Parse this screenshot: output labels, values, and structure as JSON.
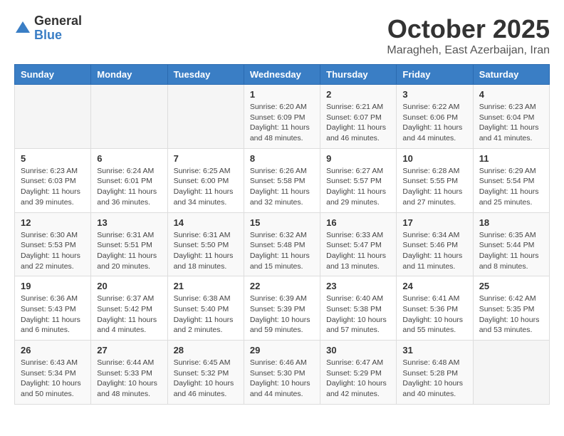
{
  "logo": {
    "general": "General",
    "blue": "Blue"
  },
  "header": {
    "month": "October 2025",
    "location": "Maragheh, East Azerbaijan, Iran"
  },
  "weekdays": [
    "Sunday",
    "Monday",
    "Tuesday",
    "Wednesday",
    "Thursday",
    "Friday",
    "Saturday"
  ],
  "weeks": [
    [
      {
        "day": "",
        "info": ""
      },
      {
        "day": "",
        "info": ""
      },
      {
        "day": "",
        "info": ""
      },
      {
        "day": "1",
        "info": "Sunrise: 6:20 AM\nSunset: 6:09 PM\nDaylight: 11 hours\nand 48 minutes."
      },
      {
        "day": "2",
        "info": "Sunrise: 6:21 AM\nSunset: 6:07 PM\nDaylight: 11 hours\nand 46 minutes."
      },
      {
        "day": "3",
        "info": "Sunrise: 6:22 AM\nSunset: 6:06 PM\nDaylight: 11 hours\nand 44 minutes."
      },
      {
        "day": "4",
        "info": "Sunrise: 6:23 AM\nSunset: 6:04 PM\nDaylight: 11 hours\nand 41 minutes."
      }
    ],
    [
      {
        "day": "5",
        "info": "Sunrise: 6:23 AM\nSunset: 6:03 PM\nDaylight: 11 hours\nand 39 minutes."
      },
      {
        "day": "6",
        "info": "Sunrise: 6:24 AM\nSunset: 6:01 PM\nDaylight: 11 hours\nand 36 minutes."
      },
      {
        "day": "7",
        "info": "Sunrise: 6:25 AM\nSunset: 6:00 PM\nDaylight: 11 hours\nand 34 minutes."
      },
      {
        "day": "8",
        "info": "Sunrise: 6:26 AM\nSunset: 5:58 PM\nDaylight: 11 hours\nand 32 minutes."
      },
      {
        "day": "9",
        "info": "Sunrise: 6:27 AM\nSunset: 5:57 PM\nDaylight: 11 hours\nand 29 minutes."
      },
      {
        "day": "10",
        "info": "Sunrise: 6:28 AM\nSunset: 5:55 PM\nDaylight: 11 hours\nand 27 minutes."
      },
      {
        "day": "11",
        "info": "Sunrise: 6:29 AM\nSunset: 5:54 PM\nDaylight: 11 hours\nand 25 minutes."
      }
    ],
    [
      {
        "day": "12",
        "info": "Sunrise: 6:30 AM\nSunset: 5:53 PM\nDaylight: 11 hours\nand 22 minutes."
      },
      {
        "day": "13",
        "info": "Sunrise: 6:31 AM\nSunset: 5:51 PM\nDaylight: 11 hours\nand 20 minutes."
      },
      {
        "day": "14",
        "info": "Sunrise: 6:31 AM\nSunset: 5:50 PM\nDaylight: 11 hours\nand 18 minutes."
      },
      {
        "day": "15",
        "info": "Sunrise: 6:32 AM\nSunset: 5:48 PM\nDaylight: 11 hours\nand 15 minutes."
      },
      {
        "day": "16",
        "info": "Sunrise: 6:33 AM\nSunset: 5:47 PM\nDaylight: 11 hours\nand 13 minutes."
      },
      {
        "day": "17",
        "info": "Sunrise: 6:34 AM\nSunset: 5:46 PM\nDaylight: 11 hours\nand 11 minutes."
      },
      {
        "day": "18",
        "info": "Sunrise: 6:35 AM\nSunset: 5:44 PM\nDaylight: 11 hours\nand 8 minutes."
      }
    ],
    [
      {
        "day": "19",
        "info": "Sunrise: 6:36 AM\nSunset: 5:43 PM\nDaylight: 11 hours\nand 6 minutes."
      },
      {
        "day": "20",
        "info": "Sunrise: 6:37 AM\nSunset: 5:42 PM\nDaylight: 11 hours\nand 4 minutes."
      },
      {
        "day": "21",
        "info": "Sunrise: 6:38 AM\nSunset: 5:40 PM\nDaylight: 11 hours\nand 2 minutes."
      },
      {
        "day": "22",
        "info": "Sunrise: 6:39 AM\nSunset: 5:39 PM\nDaylight: 10 hours\nand 59 minutes."
      },
      {
        "day": "23",
        "info": "Sunrise: 6:40 AM\nSunset: 5:38 PM\nDaylight: 10 hours\nand 57 minutes."
      },
      {
        "day": "24",
        "info": "Sunrise: 6:41 AM\nSunset: 5:36 PM\nDaylight: 10 hours\nand 55 minutes."
      },
      {
        "day": "25",
        "info": "Sunrise: 6:42 AM\nSunset: 5:35 PM\nDaylight: 10 hours\nand 53 minutes."
      }
    ],
    [
      {
        "day": "26",
        "info": "Sunrise: 6:43 AM\nSunset: 5:34 PM\nDaylight: 10 hours\nand 50 minutes."
      },
      {
        "day": "27",
        "info": "Sunrise: 6:44 AM\nSunset: 5:33 PM\nDaylight: 10 hours\nand 48 minutes."
      },
      {
        "day": "28",
        "info": "Sunrise: 6:45 AM\nSunset: 5:32 PM\nDaylight: 10 hours\nand 46 minutes."
      },
      {
        "day": "29",
        "info": "Sunrise: 6:46 AM\nSunset: 5:30 PM\nDaylight: 10 hours\nand 44 minutes."
      },
      {
        "day": "30",
        "info": "Sunrise: 6:47 AM\nSunset: 5:29 PM\nDaylight: 10 hours\nand 42 minutes."
      },
      {
        "day": "31",
        "info": "Sunrise: 6:48 AM\nSunset: 5:28 PM\nDaylight: 10 hours\nand 40 minutes."
      },
      {
        "day": "",
        "info": ""
      }
    ]
  ]
}
